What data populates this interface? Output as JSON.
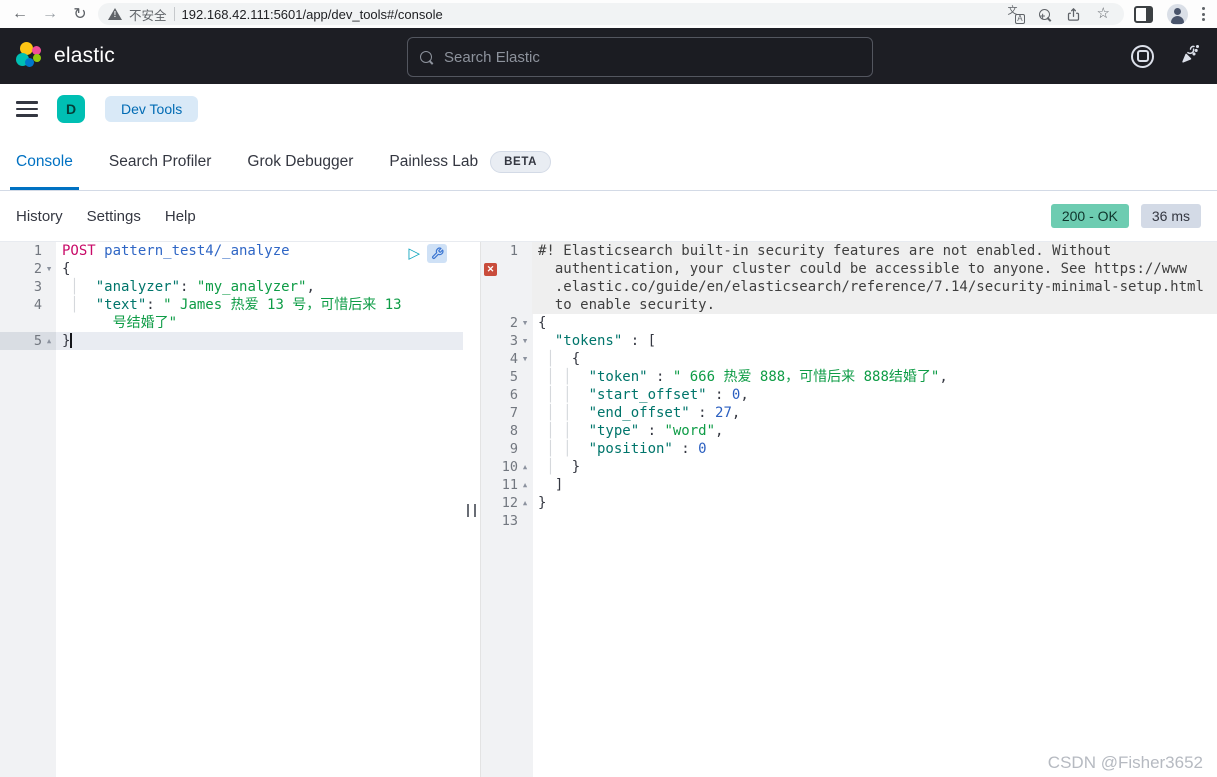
{
  "browser": {
    "security_label": "不安全",
    "url": "192.168.42.111:5601/app/dev_tools#/console"
  },
  "header": {
    "brand": "elastic",
    "search_placeholder": "Search Elastic"
  },
  "nav": {
    "space_initial": "D",
    "breadcrumb": "Dev Tools"
  },
  "tabs": [
    {
      "label": "Console",
      "active": true
    },
    {
      "label": "Search Profiler"
    },
    {
      "label": "Grok Debugger"
    },
    {
      "label": "Painless Lab",
      "badge": "BETA"
    }
  ],
  "toolbar": {
    "items": [
      "History",
      "Settings",
      "Help"
    ],
    "status": "200 - OK",
    "time": "36 ms"
  },
  "request_editor": {
    "rows": [
      {
        "num": "1",
        "seg": [
          {
            "t": "POST",
            "c": "method"
          },
          {
            "t": " pattern_test4/_analyze",
            "c": "url"
          }
        ]
      },
      {
        "num": "2",
        "fold": "down",
        "seg": [
          {
            "t": "{",
            "c": "punct"
          }
        ]
      },
      {
        "num": "3",
        "seg": [
          {
            "t": " │  ",
            "c": "guide"
          },
          {
            "t": "\"analyzer\"",
            "c": "key"
          },
          {
            "t": ": ",
            "c": "punct"
          },
          {
            "t": "\"my_analyzer\"",
            "c": "str"
          },
          {
            "t": ",",
            "c": "punct"
          }
        ]
      },
      {
        "num": "4",
        "seg": [
          {
            "t": " │  ",
            "c": "guide"
          },
          {
            "t": "\"text\"",
            "c": "key"
          },
          {
            "t": ": ",
            "c": "punct"
          },
          {
            "t": "\" James 热爱 13 号，可惜后来 13",
            "c": "str"
          }
        ]
      },
      {
        "num": "",
        "seg": [
          {
            "t": "      ",
            "c": "guide"
          },
          {
            "t": "号结婚了\"",
            "c": "str"
          }
        ]
      },
      {
        "num": "5",
        "fold": "up",
        "hl": true,
        "cursor": true,
        "seg": [
          {
            "t": "}",
            "c": "punct"
          }
        ]
      }
    ]
  },
  "response_viewer": {
    "rows": [
      {
        "num": "1",
        "warn": true,
        "seg": [
          {
            "t": "#! Elasticsearch built-in security features are not enabled. Without",
            "c": "comment"
          }
        ]
      },
      {
        "num": "",
        "warn": true,
        "icon": "error",
        "seg": [
          {
            "t": "  authentication, your cluster could be accessible to anyone. See https://www",
            "c": "comment"
          }
        ]
      },
      {
        "num": "",
        "warn": true,
        "seg": [
          {
            "t": "  .elastic.co/guide/en/elasticsearch/reference/7.14/security-minimal-setup.html",
            "c": "comment"
          }
        ]
      },
      {
        "num": "",
        "warn": true,
        "seg": [
          {
            "t": "  to enable security.",
            "c": "comment"
          }
        ]
      },
      {
        "num": "2",
        "fold": "down",
        "seg": [
          {
            "t": "{",
            "c": "punct"
          }
        ]
      },
      {
        "num": "3",
        "fold": "down",
        "seg": [
          {
            "t": "  ",
            "c": "guide"
          },
          {
            "t": "\"tokens\"",
            "c": "key"
          },
          {
            "t": " : ",
            "c": "punct"
          },
          {
            "t": "[",
            "c": "punct"
          }
        ]
      },
      {
        "num": "4",
        "fold": "down",
        "seg": [
          {
            "t": " │  ",
            "c": "guide"
          },
          {
            "t": "{",
            "c": "punct"
          }
        ]
      },
      {
        "num": "5",
        "seg": [
          {
            "t": " │ │  ",
            "c": "guide"
          },
          {
            "t": "\"token\"",
            "c": "key"
          },
          {
            "t": " : ",
            "c": "punct"
          },
          {
            "t": "\" 666 热爱 888，可惜后来 888结婚了\"",
            "c": "str"
          },
          {
            "t": ",",
            "c": "punct"
          }
        ]
      },
      {
        "num": "6",
        "seg": [
          {
            "t": " │ │  ",
            "c": "guide"
          },
          {
            "t": "\"start_offset\"",
            "c": "key"
          },
          {
            "t": " : ",
            "c": "punct"
          },
          {
            "t": "0",
            "c": "num"
          },
          {
            "t": ",",
            "c": "punct"
          }
        ]
      },
      {
        "num": "7",
        "seg": [
          {
            "t": " │ │  ",
            "c": "guide"
          },
          {
            "t": "\"end_offset\"",
            "c": "key"
          },
          {
            "t": " : ",
            "c": "punct"
          },
          {
            "t": "27",
            "c": "num"
          },
          {
            "t": ",",
            "c": "punct"
          }
        ]
      },
      {
        "num": "8",
        "seg": [
          {
            "t": " │ │  ",
            "c": "guide"
          },
          {
            "t": "\"type\"",
            "c": "key"
          },
          {
            "t": " : ",
            "c": "punct"
          },
          {
            "t": "\"word\"",
            "c": "str"
          },
          {
            "t": ",",
            "c": "punct"
          }
        ]
      },
      {
        "num": "9",
        "seg": [
          {
            "t": " │ │  ",
            "c": "guide"
          },
          {
            "t": "\"position\"",
            "c": "key"
          },
          {
            "t": " : ",
            "c": "punct"
          },
          {
            "t": "0",
            "c": "num"
          }
        ]
      },
      {
        "num": "10",
        "fold": "up",
        "seg": [
          {
            "t": " │  ",
            "c": "guide"
          },
          {
            "t": "}",
            "c": "punct"
          }
        ]
      },
      {
        "num": "11",
        "fold": "up",
        "seg": [
          {
            "t": "  ",
            "c": "guide"
          },
          {
            "t": "]",
            "c": "punct"
          }
        ]
      },
      {
        "num": "12",
        "fold": "up",
        "seg": [
          {
            "t": "}",
            "c": "punct"
          }
        ]
      },
      {
        "num": "13",
        "seg": []
      }
    ]
  },
  "watermark": "CSDN @Fisher3652",
  "colors": {
    "headerBg": "#1d1e24",
    "accent": "#0071c2",
    "success": "#6dccb1",
    "grayBadge": "#d3dae6",
    "method": "#c80a68",
    "url": "#2f66c5",
    "key": "#00756b",
    "str": "#0e9c46",
    "num": "#2b5fc0",
    "punct": "#343741",
    "comment": "#3f3f3f",
    "guide": "#d5d8dc",
    "lineno": "#72777f",
    "fold": "#8c929e",
    "error": "#c94c3b",
    "warnBg": "#efefef",
    "hlBg": "#e9ecf2",
    "hlGutter": "#d9dde3",
    "gutterBg": "#f1f2f4"
  }
}
